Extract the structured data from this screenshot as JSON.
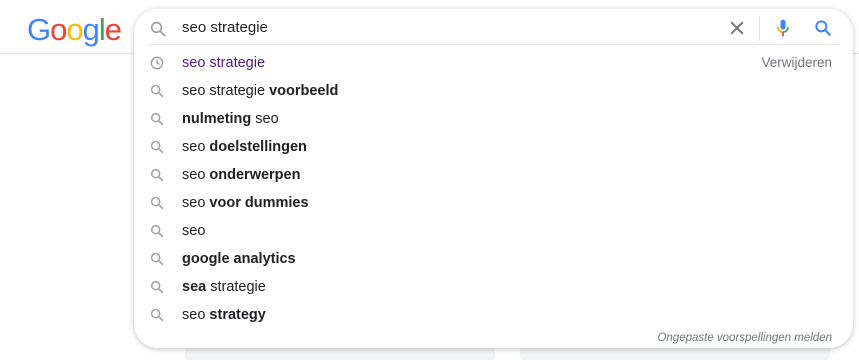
{
  "logo": {
    "text": "Google",
    "letters": [
      "G",
      "o",
      "o",
      "g",
      "l",
      "e"
    ],
    "colors": [
      "#4285F4",
      "#EA4335",
      "#FBBC05",
      "#4285F4",
      "#34A853",
      "#EA4335"
    ]
  },
  "search": {
    "query": "seo strategie",
    "clear_icon": "close-icon",
    "voice_icon": "microphone-icon",
    "search_icon": "search-icon"
  },
  "suggestions": [
    {
      "type": "history",
      "icon": "history-icon",
      "prefix": "seo strategie",
      "bold": "",
      "suffix": "",
      "action": "Verwijderen"
    },
    {
      "type": "search",
      "icon": "search-icon",
      "prefix": "seo strategie ",
      "bold": "voorbeeld",
      "suffix": ""
    },
    {
      "type": "search",
      "icon": "search-icon",
      "prefix": "",
      "bold": "nulmeting",
      "suffix": " seo"
    },
    {
      "type": "search",
      "icon": "search-icon",
      "prefix": "seo ",
      "bold": "doelstellingen",
      "suffix": ""
    },
    {
      "type": "search",
      "icon": "search-icon",
      "prefix": "seo ",
      "bold": "onderwerpen",
      "suffix": ""
    },
    {
      "type": "search",
      "icon": "search-icon",
      "prefix": "seo ",
      "bold": "voor dummies",
      "suffix": ""
    },
    {
      "type": "search",
      "icon": "search-icon",
      "prefix": "seo",
      "bold": "",
      "suffix": ""
    },
    {
      "type": "search",
      "icon": "search-icon",
      "prefix": "",
      "bold": "google analytics",
      "suffix": ""
    },
    {
      "type": "search",
      "icon": "search-icon",
      "prefix": "",
      "bold": "sea",
      "suffix": " strategie"
    },
    {
      "type": "search",
      "icon": "search-icon",
      "prefix": "seo ",
      "bold": "strategy",
      "suffix": ""
    }
  ],
  "footer": {
    "report_label": "Ongepaste voorspellingen melden"
  },
  "colors": {
    "history_text": "#52188c",
    "muted": "#70757a",
    "text": "#202124",
    "mic_blue": "#4285F4",
    "mic_red": "#EA4335",
    "mic_yellow": "#FBBC05",
    "mic_green": "#34A853",
    "search_blue": "#4285F4"
  }
}
